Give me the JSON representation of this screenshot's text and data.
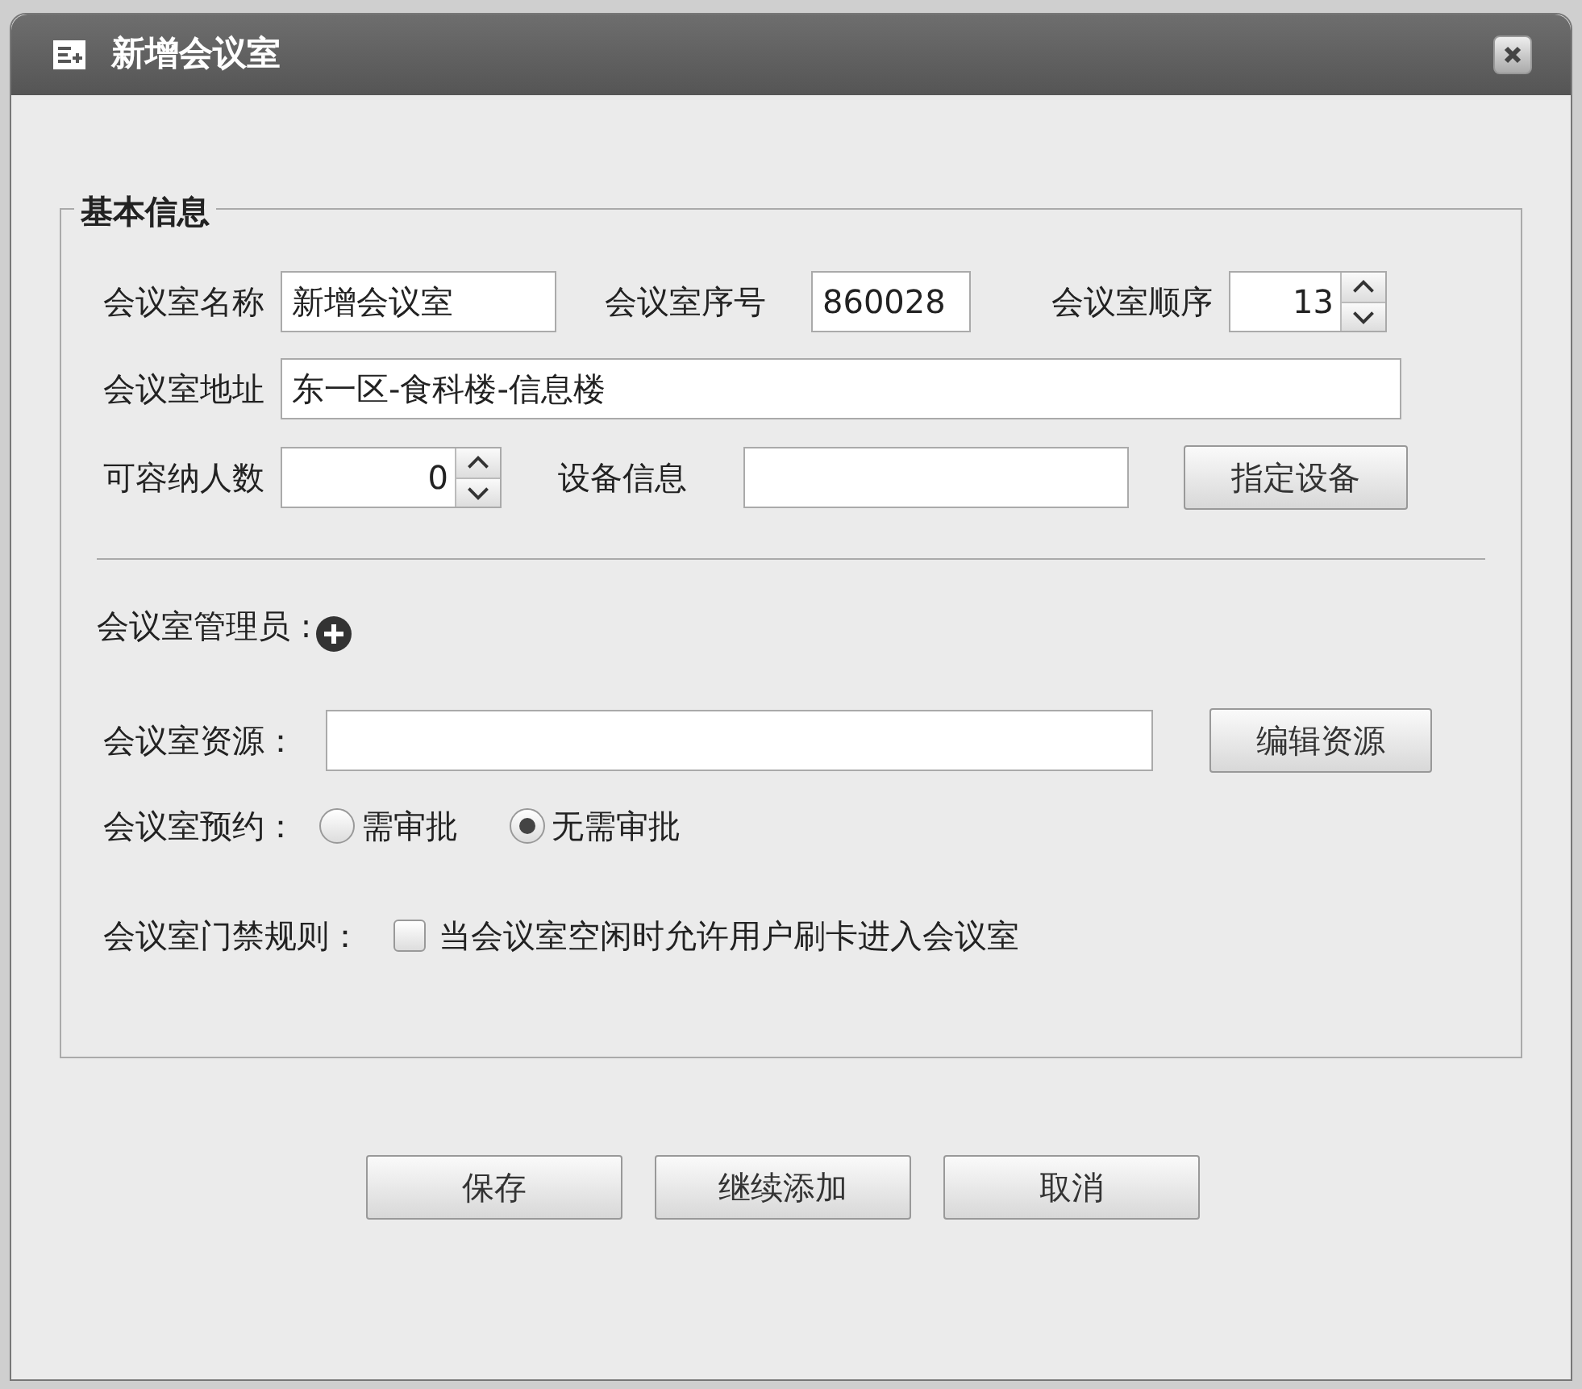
{
  "window": {
    "title": "新增会议室"
  },
  "basic": {
    "legend": "基本信息",
    "name": {
      "label": "会议室名称",
      "value": "新增会议室"
    },
    "serial": {
      "label": "会议室序号",
      "value": "860028"
    },
    "order": {
      "label": "会议室顺序",
      "value": "13"
    },
    "address": {
      "label": "会议室地址",
      "value": "东一区-食科楼-信息楼"
    },
    "capacity": {
      "label": "可容纳人数",
      "value": "0"
    },
    "equipment": {
      "label": "设备信息",
      "button": "指定设备"
    },
    "admin": {
      "label": "会议室管理员 :"
    },
    "resource": {
      "label": "会议室资源：",
      "button": "编辑资源"
    },
    "reservation": {
      "label": "会议室预约：",
      "options": [
        {
          "label": "需审批",
          "selected": false
        },
        {
          "label": "无需审批",
          "selected": true
        }
      ]
    },
    "access": {
      "label": "会议室门禁规则：",
      "checkbox": {
        "label": "当会议室空闲时允许用户刷卡进入会议室",
        "checked": false
      }
    }
  },
  "buttons": [
    "保存",
    "继续添加",
    "取消"
  ]
}
